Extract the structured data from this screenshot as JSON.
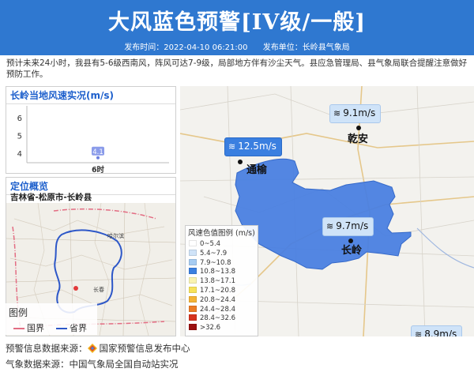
{
  "header": {
    "title": "大风蓝色预警[IV级/一般]",
    "publish_time_label": "发布时间：2022-04-10 06:21:00",
    "publisher_label": "发布单位：长岭县气象局",
    "bg_color": "#2f78d0"
  },
  "description": "预计未来24小时，我县有5-6级西南风，阵风可达7-9级，局部地方伴有沙尘天气。县应急管理局、县气象局联合提醒注意做好预防工作。",
  "wind_panel": {
    "title": "长岭当地风速实况",
    "unit": "(m/s)"
  },
  "chart_data": {
    "type": "scatter",
    "title": "长岭当地风速实况(m/s)",
    "x": [
      "6时"
    ],
    "y": [
      4.1
    ],
    "data_labels": [
      "4.1"
    ],
    "yticks": [
      "6",
      "5",
      "4"
    ],
    "ylim": [
      4,
      6.5
    ],
    "grid": false
  },
  "location_panel": {
    "title": "定位概览",
    "subtitle": "吉林省-松原市-长岭县",
    "mini_map_labels": [
      "哈尔滨",
      "长春"
    ],
    "legend": {
      "title": "图例",
      "items": [
        {
          "label": "国界",
          "color": "#e36d83"
        },
        {
          "label": "省界",
          "color": "#2d57c8"
        }
      ]
    }
  },
  "main_map": {
    "wind_tags": [
      {
        "text": "9.1m/s",
        "strong": false
      },
      {
        "text": "12.5m/s",
        "strong": true
      },
      {
        "text": "9.7m/s",
        "strong": false
      },
      {
        "text": "8.9m/s",
        "strong": false
      }
    ],
    "places": [
      "乾安",
      "通榆",
      "长岭"
    ],
    "county_fill_color": "#4a7fe0"
  },
  "wind_scale": {
    "title": "风速色值图例 (m/s)",
    "rows": [
      {
        "label": "0~5.4",
        "color": "#ffffff"
      },
      {
        "label": "5.4~7.9",
        "color": "#cfe3f8"
      },
      {
        "label": "7.9~10.8",
        "color": "#a6ccf2"
      },
      {
        "label": "10.8~13.8",
        "color": "#3a7fe0"
      },
      {
        "label": "13.8~17.1",
        "color": "#f9f3b0"
      },
      {
        "label": "17.1~20.8",
        "color": "#f7e25a"
      },
      {
        "label": "20.8~24.4",
        "color": "#f4b335"
      },
      {
        "label": "24.4~28.4",
        "color": "#ec7b24"
      },
      {
        "label": "28.4~32.6",
        "color": "#d6331d"
      },
      {
        "label": ">32.6",
        "color": "#9b1010"
      }
    ]
  },
  "sources": {
    "warning_source": "预警信息数据来源：",
    "warning_source_name": "国家预警信息发布中心",
    "weather_source": "气象数据来源：中国气象局全国自动站实况"
  }
}
